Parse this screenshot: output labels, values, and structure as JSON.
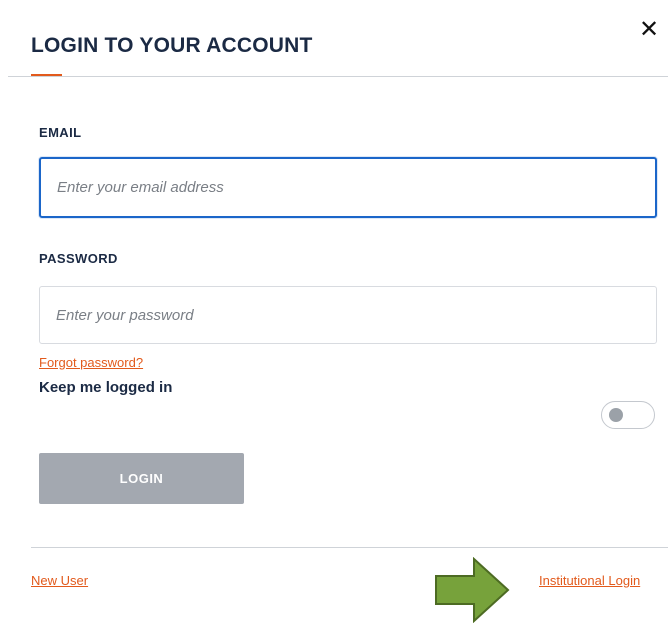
{
  "dialog": {
    "title": "LOGIN TO YOUR ACCOUNT",
    "close_symbol": "✕",
    "close_icon": "close-icon"
  },
  "email": {
    "label": "EMAIL",
    "placeholder": "Enter your email address",
    "value": ""
  },
  "password": {
    "label": "PASSWORD",
    "placeholder": "Enter your password",
    "value": ""
  },
  "forgot_password": "Forgot password?",
  "keep_logged_in": {
    "label": "Keep me logged in",
    "enabled": false
  },
  "login_button": "LOGIN",
  "footer": {
    "new_user": "New User",
    "institutional_login": "Institutional Login"
  },
  "annotation": {
    "icon": "right-arrow-icon",
    "fill_color": "#77a23b",
    "stroke_color": "#4d6b23"
  },
  "colors": {
    "accent": "#e25a1c",
    "focus": "#1b66c9",
    "heading": "#1b2a44",
    "button_disabled": "#a3a8b0"
  }
}
